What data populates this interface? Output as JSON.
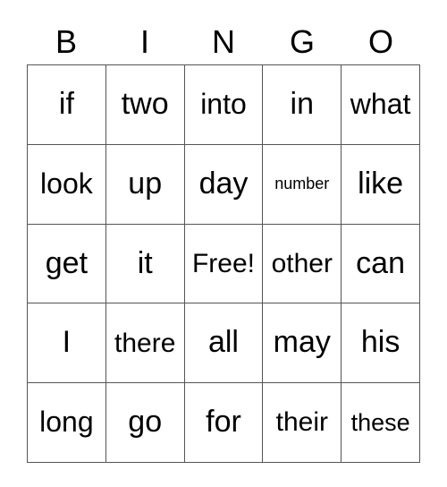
{
  "card": {
    "title": "BINGO",
    "border_color": "#555555",
    "background_color": "#ffffff",
    "text_color": "#000000"
  },
  "header": {
    "letters": [
      "B",
      "I",
      "N",
      "G",
      "O"
    ]
  },
  "grid": {
    "columns": 5,
    "rows": 5,
    "cells": [
      [
        {
          "text": "if",
          "size": "size-xl"
        },
        {
          "text": "two",
          "size": "size-xl"
        },
        {
          "text": "into",
          "size": "size-l"
        },
        {
          "text": "in",
          "size": "size-xl"
        },
        {
          "text": "what",
          "size": "size-l"
        }
      ],
      [
        {
          "text": "look",
          "size": "size-l"
        },
        {
          "text": "up",
          "size": "size-xl"
        },
        {
          "text": "day",
          "size": "size-xl"
        },
        {
          "text": "number",
          "size": "size-xs"
        },
        {
          "text": "like",
          "size": "size-xl"
        }
      ],
      [
        {
          "text": "get",
          "size": "size-xl"
        },
        {
          "text": "it",
          "size": "size-xl"
        },
        {
          "text": "Free!",
          "size": "size-m"
        },
        {
          "text": "other",
          "size": "size-m"
        },
        {
          "text": "can",
          "size": "size-xl"
        }
      ],
      [
        {
          "text": "I",
          "size": "size-xl"
        },
        {
          "text": "there",
          "size": "size-m"
        },
        {
          "text": "all",
          "size": "size-xl"
        },
        {
          "text": "may",
          "size": "size-xl"
        },
        {
          "text": "his",
          "size": "size-xl"
        }
      ],
      [
        {
          "text": "long",
          "size": "size-l"
        },
        {
          "text": "go",
          "size": "size-xl"
        },
        {
          "text": "for",
          "size": "size-xl"
        },
        {
          "text": "their",
          "size": "size-m"
        },
        {
          "text": "these",
          "size": "size-s"
        }
      ]
    ]
  }
}
